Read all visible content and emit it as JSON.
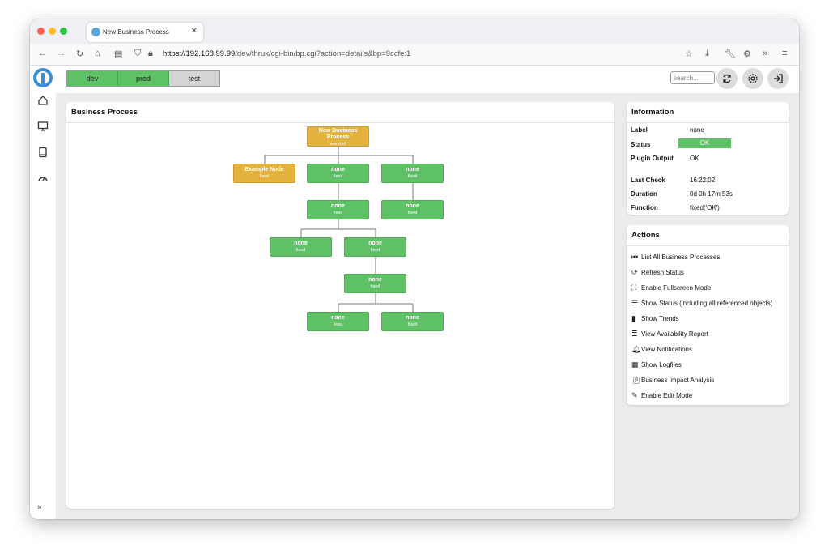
{
  "browser": {
    "tab_title": "New Business Process",
    "url_host": "https://192.168.99.99",
    "url_path": "/dev/thruk/cgi-bin/bp.cgi?action=details&bp=9ccfe:1"
  },
  "topbar": {
    "envs": [
      "dev",
      "prod",
      "test"
    ],
    "search_placeholder": "search..."
  },
  "business_process": {
    "title": "Business Process",
    "nodes": [
      {
        "label": "New Business Process",
        "sub": "worst of",
        "color": "#e3b33e"
      },
      {
        "label": "Example Node",
        "sub": "fixed",
        "color": "#e3b33e"
      },
      {
        "label": "none",
        "sub": "fixed",
        "color": "#5ec166"
      },
      {
        "label": "none",
        "sub": "fixed",
        "color": "#5ec166"
      },
      {
        "label": "none",
        "sub": "fixed",
        "color": "#5ec166"
      },
      {
        "label": "none",
        "sub": "fixed",
        "color": "#5ec166"
      },
      {
        "label": "none",
        "sub": "fixed",
        "color": "#5ec166"
      },
      {
        "label": "none",
        "sub": "fixed",
        "color": "#5ec166"
      },
      {
        "label": "none",
        "sub": "fixed",
        "color": "#5ec166"
      },
      {
        "label": "none",
        "sub": "fixed",
        "color": "#5ec166"
      },
      {
        "label": "none",
        "sub": "fixed",
        "color": "#5ec166"
      }
    ]
  },
  "information": {
    "title": "Information",
    "rows": [
      {
        "label": "Label",
        "value": "none"
      },
      {
        "label": "Status",
        "value": "OK"
      },
      {
        "label": "Plugin Output",
        "value": "OK"
      },
      {
        "label": "Last Check",
        "value": "16:22:02"
      },
      {
        "label": "Duration",
        "value": "0d 0h 17m 53s"
      },
      {
        "label": "Function",
        "value": "fixed('OK')"
      }
    ]
  },
  "actions": {
    "title": "Actions",
    "items": [
      {
        "label": "List All Business Processes",
        "icon": "skip-back-icon"
      },
      {
        "label": "Refresh Status",
        "icon": "refresh-icon"
      },
      {
        "label": "Enable Fullscreen Mode",
        "icon": "fullscreen-icon"
      },
      {
        "label": "Show Status  (including all referenced objects)",
        "icon": "list-icon"
      },
      {
        "label": "Show Trends",
        "icon": "bar-chart-icon"
      },
      {
        "label": "View Availability Report",
        "icon": "align-center-icon"
      },
      {
        "label": "View Notifications",
        "icon": "bell-icon"
      },
      {
        "label": "Show Logfiles",
        "icon": "table-icon"
      },
      {
        "label": "Business Impact Analysis",
        "icon": "clipboard-icon"
      },
      {
        "label": "Enable Edit Mode",
        "icon": "pencil-icon"
      }
    ]
  },
  "colors": {
    "ok": "#5ec166",
    "warning": "#e3b33e",
    "accent": "#3a8fd6"
  }
}
